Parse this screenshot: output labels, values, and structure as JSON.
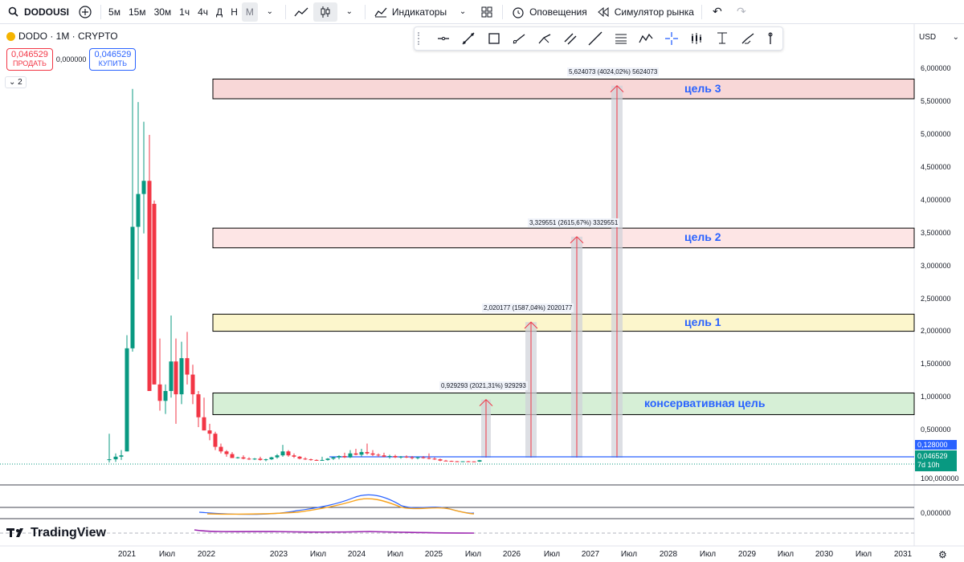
{
  "topbar": {
    "symbol": "DODOUSI",
    "intervals": [
      "5м",
      "15м",
      "30м",
      "1ч",
      "4ч",
      "Д",
      "Н",
      "М"
    ],
    "active_interval": "М",
    "indicators": "Индикаторы",
    "alerts": "Оповещения",
    "replay": "Симулятор рынка"
  },
  "legend": {
    "title": "DODO · 1M · CRYPTO",
    "sell_price": "0,046529",
    "sell_label": "ПРОДАТЬ",
    "spread": "0,000000",
    "buy_price": "0,046529",
    "buy_label": "КУПИТЬ",
    "collapse_count": "2"
  },
  "currency": "USD",
  "zones": [
    {
      "label": "цель 3",
      "top": 5.85,
      "bottom": 5.55,
      "color": "#f8d7d7",
      "border": "#000000"
    },
    {
      "label": "цель 2",
      "top": 3.58,
      "bottom": 3.28,
      "color": "#fde5e5",
      "border": "#000000"
    },
    {
      "label": "цель 1",
      "top": 2.27,
      "bottom": 2.01,
      "color": "#fcf6cc",
      "border": "#000000"
    },
    {
      "label": "консервативная цель",
      "top": 1.07,
      "bottom": 0.74,
      "color": "#d6efd6",
      "border": "#000000"
    }
  ],
  "measures": [
    {
      "text": "5,624073 (4024,02%) 5624073",
      "value": 5.75
    },
    {
      "text": "3,329551 (2615,67%) 3329551",
      "value": 3.45
    },
    {
      "text": "2,020177 (1587,04%) 2020177",
      "value": 2.15
    },
    {
      "text": "0,929293 (2021,31%) 929293",
      "value": 0.97
    }
  ],
  "y_axis": [
    "6,000000",
    "5,500000",
    "5,000000",
    "4,500000",
    "4,000000",
    "3,500000",
    "3,000000",
    "2,500000",
    "2,000000",
    "1,500000",
    "1,000000",
    "0,500000"
  ],
  "badges": {
    "high": "0,128000",
    "last": "0,046529",
    "countdown": "7d 10h"
  },
  "indicator_axis": [
    "100,000000",
    "0,000000"
  ],
  "x_axis": [
    "2021",
    "Июл",
    "2022",
    "2023",
    "Июл",
    "2024",
    "Июл",
    "2025",
    "Июл",
    "2026",
    "Июл",
    "2027",
    "Июл",
    "2028",
    "Июл",
    "2029",
    "Июл",
    "2030",
    "Июл",
    "2031"
  ],
  "brand": "TradingView",
  "colors": {
    "up": "#089981",
    "down": "#f23645",
    "zone_text": "#2962ff",
    "line": "#2962ff"
  }
}
